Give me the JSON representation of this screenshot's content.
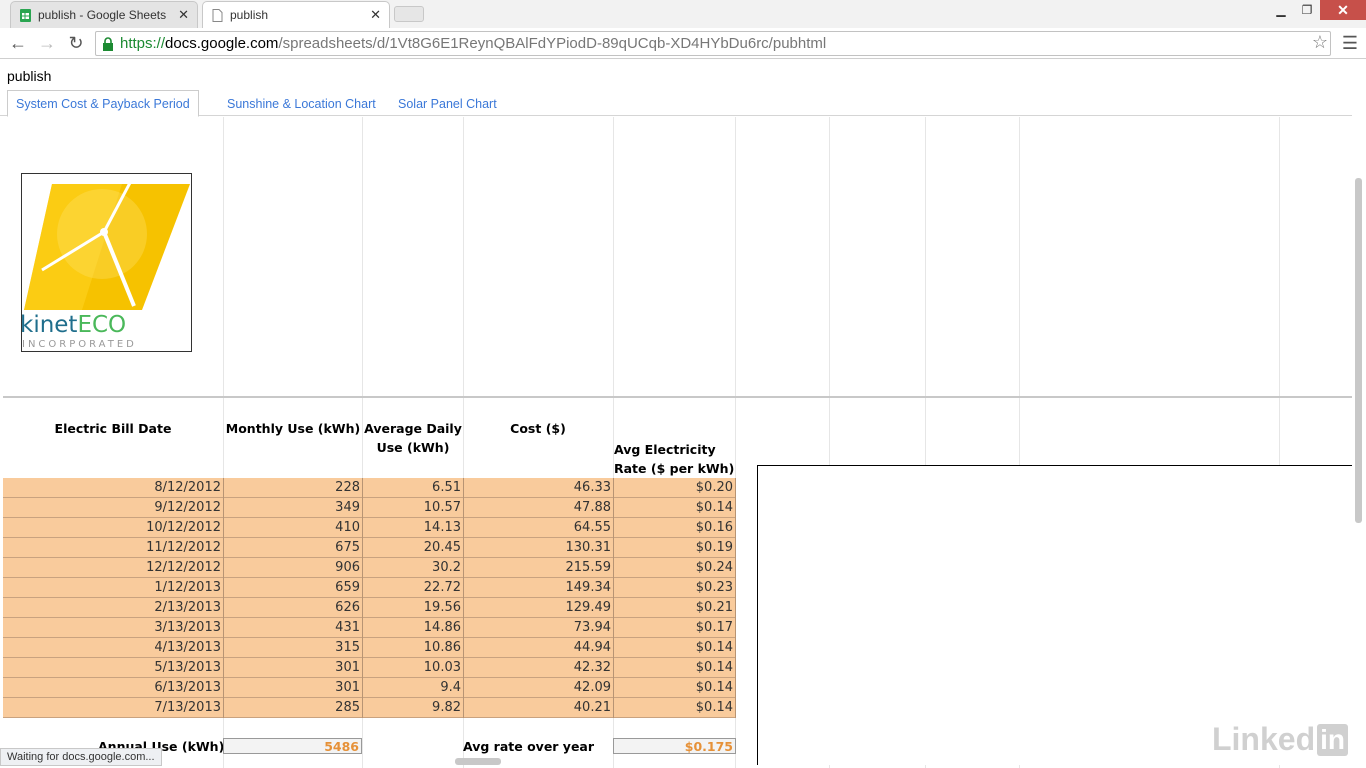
{
  "browser": {
    "tabs": [
      {
        "title": "publish - Google Sheets",
        "active": false
      },
      {
        "title": "publish",
        "active": true
      }
    ],
    "url_scheme": "https://",
    "url_host": "docs.google.com",
    "url_path": "/spreadsheets/d/1Vt8G6E1ReynQBAlFdYPiodD-89qUCqb-XD4HYbDu6rc/pubhtml",
    "status_text": "Waiting for docs.google.com..."
  },
  "document": {
    "title": "publish",
    "sheet_tabs": [
      "System Cost & Payback Period",
      "Sunshine & Location Chart",
      "Solar Panel Chart"
    ]
  },
  "logo": {
    "brand_text_a": "kinet",
    "brand_text_b": "ECO",
    "tagline": "INCORPORATED"
  },
  "table": {
    "headers": {
      "date": "Electric Bill Date",
      "monthly": "Monthly Use (kWh)",
      "avg_daily_line1": "Average Daily",
      "avg_daily_line2": "Use (kWh)",
      "cost": "Cost ($)",
      "rate_line1": "Avg Electricity",
      "rate_line2": "Rate ($ per kWh)"
    },
    "rows": [
      [
        "8/12/2012",
        "228",
        "6.51",
        "46.33",
        "$0.20"
      ],
      [
        "9/12/2012",
        "349",
        "10.57",
        "47.88",
        "$0.14"
      ],
      [
        "10/12/2012",
        "410",
        "14.13",
        "64.55",
        "$0.16"
      ],
      [
        "11/12/2012",
        "675",
        "20.45",
        "130.31",
        "$0.19"
      ],
      [
        "12/12/2012",
        "906",
        "30.2",
        "215.59",
        "$0.24"
      ],
      [
        "1/12/2013",
        "659",
        "22.72",
        "149.34",
        "$0.23"
      ],
      [
        "2/13/2013",
        "626",
        "19.56",
        "129.49",
        "$0.21"
      ],
      [
        "3/13/2013",
        "431",
        "14.86",
        "73.94",
        "$0.17"
      ],
      [
        "4/13/2013",
        "315",
        "10.86",
        "44.94",
        "$0.14"
      ],
      [
        "5/13/2013",
        "301",
        "10.03",
        "42.32",
        "$0.14"
      ],
      [
        "6/13/2013",
        "301",
        "9.4",
        "42.09",
        "$0.14"
      ],
      [
        "7/13/2013",
        "285",
        "9.82",
        "40.21",
        "$0.14"
      ]
    ],
    "footer": {
      "annual_label": "Annual Use (kWh)",
      "annual_value": "5486",
      "avg_rate_label": "Avg rate over year",
      "avg_rate_value": "$0.175"
    }
  },
  "watermark": {
    "text": "Linked",
    "suffix": "in"
  },
  "colors": {
    "row_fill": "#f9cb9c",
    "tab_link": "#3b78d8",
    "accent_orange": "#e69138"
  }
}
